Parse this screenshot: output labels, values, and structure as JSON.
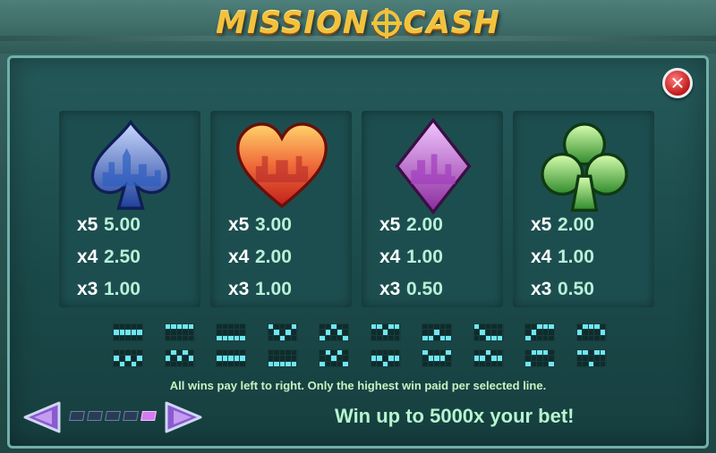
{
  "header": {
    "logo_left": "MISSION",
    "logo_right": "CASH"
  },
  "paytable": [
    {
      "suit": "spade",
      "icon": "spade-icon",
      "color": "#3a5fbf",
      "rows": [
        {
          "mult": "x5",
          "val": "5.00"
        },
        {
          "mult": "x4",
          "val": "2.50"
        },
        {
          "mult": "x3",
          "val": "1.00"
        }
      ]
    },
    {
      "suit": "heart",
      "icon": "heart-icon",
      "color": "#e23b2c",
      "rows": [
        {
          "mult": "x5",
          "val": "3.00"
        },
        {
          "mult": "x4",
          "val": "2.00"
        },
        {
          "mult": "x3",
          "val": "1.00"
        }
      ]
    },
    {
      "suit": "diamond",
      "icon": "diamond-icon",
      "color": "#b63fb6",
      "rows": [
        {
          "mult": "x5",
          "val": "2.00"
        },
        {
          "mult": "x4",
          "val": "1.00"
        },
        {
          "mult": "x3",
          "val": "0.50"
        }
      ]
    },
    {
      "suit": "club",
      "icon": "club-icon",
      "color": "#3aa53a",
      "rows": [
        {
          "mult": "x5",
          "val": "2.00"
        },
        {
          "mult": "x4",
          "val": "1.00"
        },
        {
          "mult": "x3",
          "val": "0.50"
        }
      ]
    }
  ],
  "paylines": [
    [
      [
        0,
        0,
        0,
        0,
        0
      ],
      [
        1,
        1,
        1,
        1,
        1
      ],
      [
        0,
        0,
        0,
        0,
        0
      ]
    ],
    [
      [
        1,
        1,
        1,
        1,
        1
      ],
      [
        0,
        0,
        0,
        0,
        0
      ],
      [
        0,
        0,
        0,
        0,
        0
      ]
    ],
    [
      [
        0,
        0,
        0,
        0,
        0
      ],
      [
        0,
        0,
        0,
        0,
        0
      ],
      [
        1,
        1,
        1,
        1,
        1
      ]
    ],
    [
      [
        1,
        0,
        0,
        0,
        1
      ],
      [
        0,
        1,
        0,
        1,
        0
      ],
      [
        0,
        0,
        1,
        0,
        0
      ]
    ],
    [
      [
        0,
        0,
        1,
        0,
        0
      ],
      [
        0,
        1,
        0,
        1,
        0
      ],
      [
        1,
        0,
        0,
        0,
        1
      ]
    ],
    [
      [
        1,
        1,
        0,
        1,
        1
      ],
      [
        0,
        0,
        1,
        0,
        0
      ],
      [
        0,
        0,
        0,
        0,
        0
      ]
    ],
    [
      [
        0,
        0,
        0,
        0,
        0
      ],
      [
        0,
        0,
        1,
        0,
        0
      ],
      [
        1,
        1,
        0,
        1,
        1
      ]
    ],
    [
      [
        1,
        0,
        0,
        0,
        0
      ],
      [
        0,
        1,
        0,
        0,
        0
      ],
      [
        0,
        0,
        1,
        1,
        1
      ]
    ],
    [
      [
        0,
        0,
        1,
        1,
        1
      ],
      [
        0,
        1,
        0,
        0,
        0
      ],
      [
        1,
        0,
        0,
        0,
        0
      ]
    ],
    [
      [
        0,
        1,
        1,
        1,
        0
      ],
      [
        1,
        0,
        0,
        0,
        1
      ],
      [
        0,
        0,
        0,
        0,
        0
      ]
    ],
    [
      [
        0,
        0,
        0,
        0,
        0
      ],
      [
        1,
        0,
        1,
        0,
        1
      ],
      [
        0,
        1,
        0,
        1,
        0
      ]
    ],
    [
      [
        0,
        1,
        0,
        1,
        0
      ],
      [
        1,
        0,
        1,
        0,
        1
      ],
      [
        0,
        0,
        0,
        0,
        0
      ]
    ],
    [
      [
        0,
        0,
        0,
        0,
        0
      ],
      [
        1,
        1,
        1,
        1,
        1
      ],
      [
        0,
        0,
        0,
        0,
        0
      ]
    ],
    [
      [
        0,
        0,
        0,
        0,
        0
      ],
      [
        0,
        0,
        0,
        0,
        0
      ],
      [
        1,
        1,
        1,
        1,
        1
      ]
    ],
    [
      [
        0,
        1,
        0,
        1,
        0
      ],
      [
        0,
        0,
        1,
        0,
        0
      ],
      [
        1,
        0,
        0,
        0,
        1
      ]
    ],
    [
      [
        0,
        0,
        0,
        0,
        0
      ],
      [
        1,
        1,
        0,
        1,
        1
      ],
      [
        0,
        0,
        1,
        0,
        0
      ]
    ],
    [
      [
        1,
        0,
        0,
        0,
        1
      ],
      [
        0,
        1,
        1,
        1,
        0
      ],
      [
        0,
        0,
        0,
        0,
        0
      ]
    ],
    [
      [
        0,
        0,
        1,
        0,
        0
      ],
      [
        1,
        1,
        0,
        1,
        1
      ],
      [
        0,
        0,
        0,
        0,
        0
      ]
    ],
    [
      [
        0,
        1,
        1,
        1,
        0
      ],
      [
        0,
        0,
        0,
        0,
        0
      ],
      [
        1,
        0,
        0,
        0,
        1
      ]
    ],
    [
      [
        1,
        1,
        0,
        1,
        1
      ],
      [
        0,
        0,
        0,
        0,
        0
      ],
      [
        0,
        0,
        1,
        0,
        0
      ]
    ]
  ],
  "rules_text": "All wins pay left to right. Only the highest win paid per selected line.",
  "win_text": "Win up to 5000x your bet!",
  "pager": {
    "total": 5,
    "active": 5
  },
  "colors": {
    "accent": "#b6f5cf",
    "close": "#c01818",
    "nav": "#7b4fc4"
  }
}
